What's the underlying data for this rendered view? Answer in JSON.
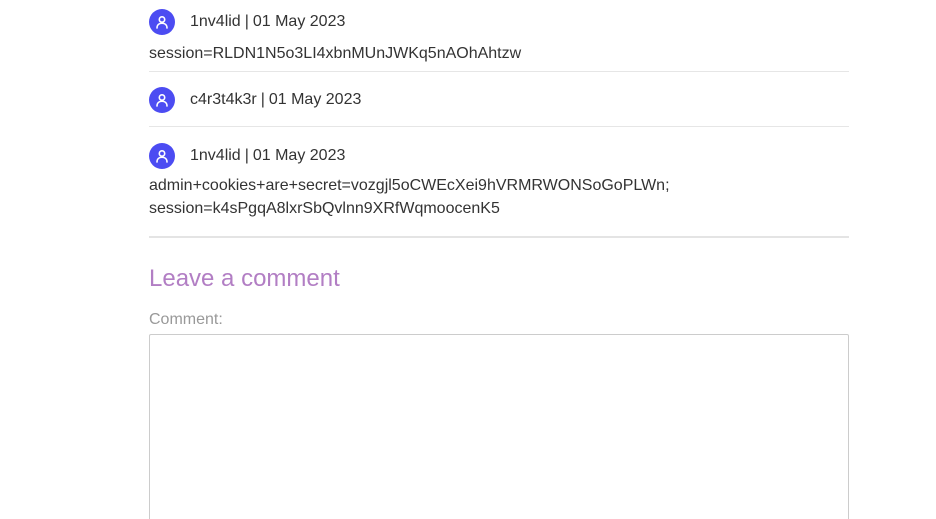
{
  "comments": [
    {
      "author": "1nv4lid",
      "separator": "|",
      "date": "01 May 2023",
      "lines": [
        "session=RLDN1N5o3LI4xbnMUnJWKq5nAOhAhtzw"
      ]
    },
    {
      "author": "c4r3t4k3r",
      "separator": "|",
      "date": "01 May 2023",
      "lines": []
    },
    {
      "author": "1nv4lid",
      "separator": "|",
      "date": "01 May 2023",
      "lines": [
        "admin+cookies+are+secret=vozgjl5oCWEcXei9hVRMRWONSoGoPLWn;",
        "session=k4sPgqA8lxrSbQvlnn9XRfWqmoocenK5"
      ]
    }
  ],
  "leave_comment": {
    "title": "Leave a comment",
    "label": "Comment:",
    "value": ""
  },
  "colors": {
    "avatar": "#4c4cf2",
    "heading": "#b27ec4",
    "label": "#999999",
    "text": "#333333"
  },
  "icons": {
    "avatar": "user-icon"
  }
}
